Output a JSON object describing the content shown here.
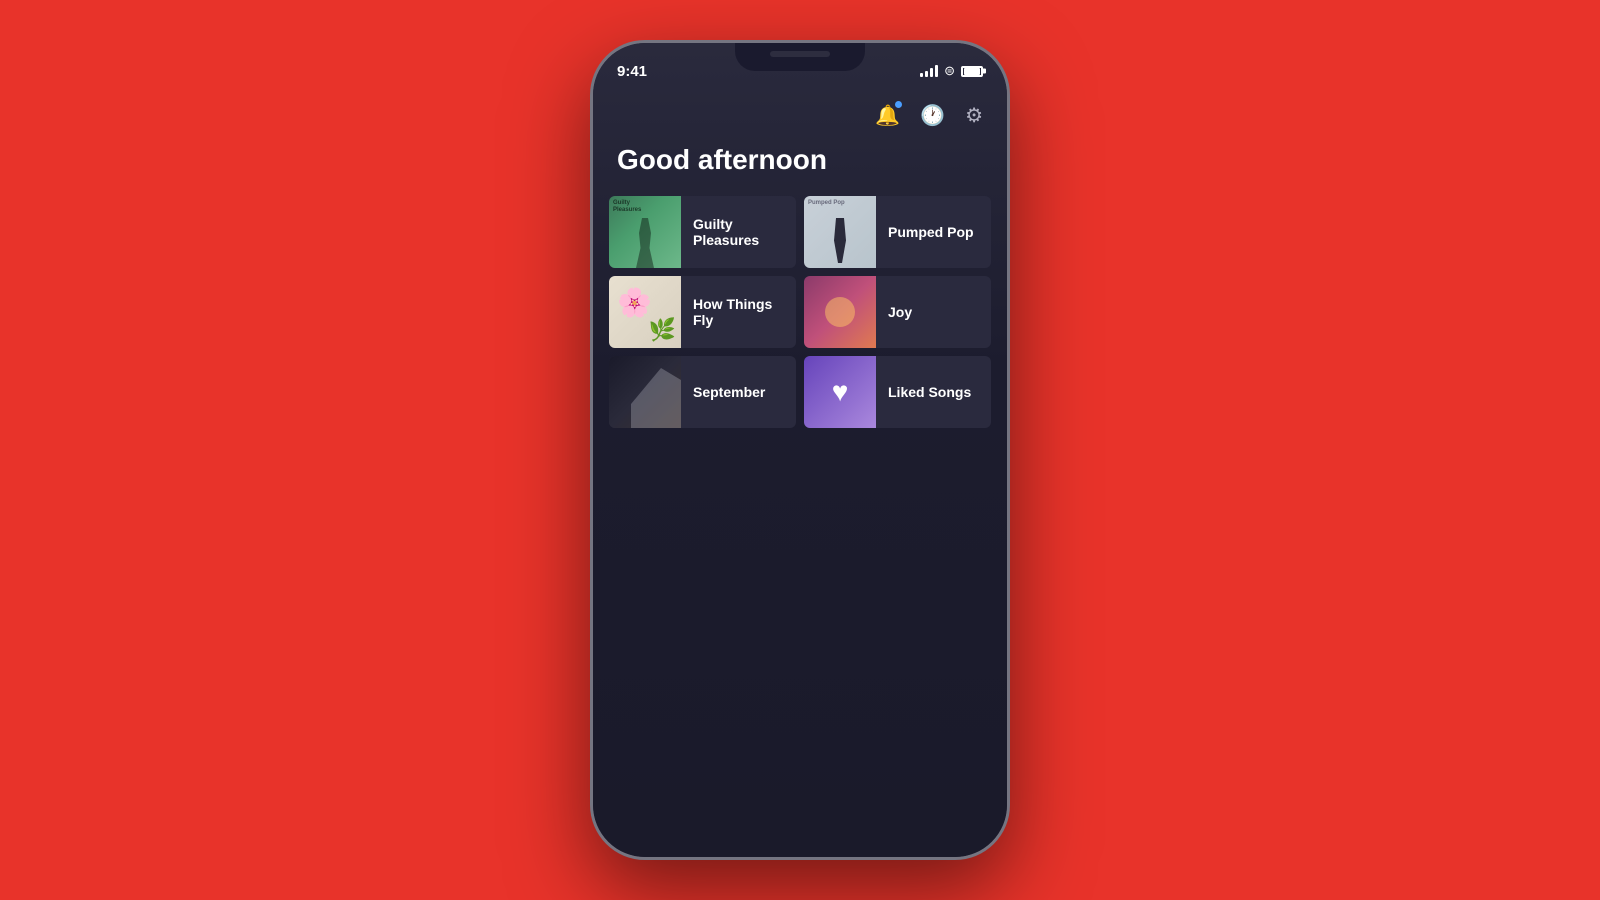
{
  "background_color": "#e8332a",
  "phone": {
    "status_bar": {
      "time": "9:41",
      "signal_bars": 4,
      "wifi": true,
      "battery_full": true
    },
    "top_icons": {
      "bell_label": "🔔",
      "history_label": "🕐",
      "settings_label": "⚙"
    },
    "greeting": "Good afternoon",
    "playlists": [
      {
        "id": "guilty-pleasures",
        "label": "Guilty Pleasures",
        "thumb_type": "guilty"
      },
      {
        "id": "pumped-pop",
        "label": "Pumped Pop",
        "thumb_type": "pumped"
      },
      {
        "id": "how-things-fly",
        "label": "How Things Fly",
        "thumb_type": "how"
      },
      {
        "id": "joy",
        "label": "Joy",
        "thumb_type": "joy"
      },
      {
        "id": "september",
        "label": "September",
        "thumb_type": "september"
      },
      {
        "id": "liked-songs",
        "label": "Liked Songs",
        "thumb_type": "liked"
      }
    ]
  }
}
